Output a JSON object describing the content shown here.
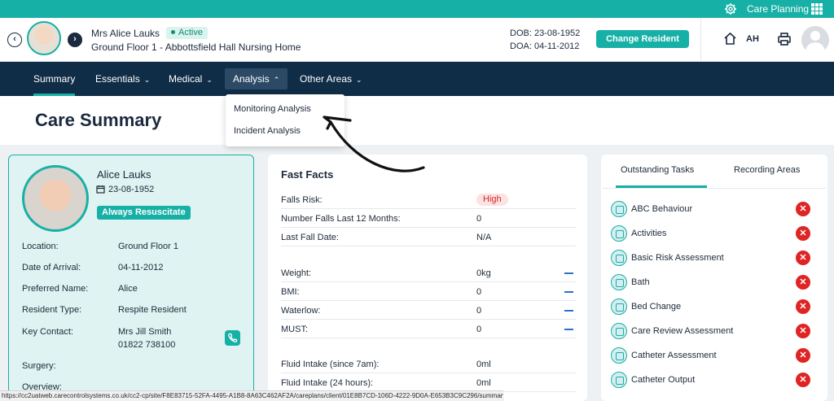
{
  "topbar": {
    "link_label": "Care Planning",
    "settings_icon": "gear-icon",
    "apps_icon": "grid-icon"
  },
  "header": {
    "resident_name": "Mrs Alice Lauks",
    "status": "Active",
    "location": "Ground Floor 1 - Abbottsfield Hall Nursing Home",
    "dob": "DOB: 23-08-1952",
    "doa": "DOA: 04-11-2012",
    "change_button": "Change Resident",
    "user_initials": "AH",
    "prev_label": "‹",
    "next_label": "›"
  },
  "nav": {
    "items": [
      {
        "label": "Summary",
        "active": true
      },
      {
        "label": "Essentials"
      },
      {
        "label": "Medical"
      },
      {
        "label": "Analysis",
        "open": true
      },
      {
        "label": "Other Areas"
      }
    ],
    "chev_down": "⌄",
    "chev_up": "⌃"
  },
  "dropdown": {
    "items": [
      "Monitoring Analysis",
      "Incident Analysis"
    ]
  },
  "page": {
    "title": "Care Summary"
  },
  "profile": {
    "name": "Alice Lauks",
    "dob": "23-08-1952",
    "resus_badge": "Always Resuscitate",
    "fields": [
      {
        "label": "Location:",
        "value": "Ground Floor 1"
      },
      {
        "label": "Date of Arrival:",
        "value": "04-11-2012"
      },
      {
        "label": "Preferred Name:",
        "value": "Alice"
      },
      {
        "label": "Resident Type:",
        "value": "Respite Resident"
      },
      {
        "label": "Key Contact:",
        "value": "Mrs Jill Smith",
        "value2": "01822 738100"
      },
      {
        "label": "Surgery:",
        "value": ""
      },
      {
        "label": "Overview:",
        "value": ""
      }
    ]
  },
  "fast_facts": {
    "title": "Fast Facts",
    "rows": [
      {
        "label": "Falls Risk:",
        "value": "High"
      },
      {
        "label": "Number Falls Last 12 Months:",
        "value": "0"
      },
      {
        "label": "Last Fall Date:",
        "value": "N/A"
      },
      {
        "label": "Weight:",
        "value": "0kg"
      },
      {
        "label": "BMI:",
        "value": "0"
      },
      {
        "label": "Waterlow:",
        "value": "0"
      },
      {
        "label": "MUST:",
        "value": "0"
      },
      {
        "label": "Fluid Intake (since 7am):",
        "value": "0ml"
      },
      {
        "label": "Fluid Intake (24 hours):",
        "value": "0ml"
      }
    ]
  },
  "tasks_panel": {
    "tabs": [
      "Outstanding Tasks",
      "Recording Areas"
    ],
    "tasks": [
      "ABC Behaviour",
      "Activities",
      "Basic Risk Assessment",
      "Bath",
      "Bed Change",
      "Care Review Assessment",
      "Catheter Assessment",
      "Catheter Output"
    ],
    "remove_glyph": "✕"
  },
  "status_bar": {
    "url": "https://cc2uatweb.carecontrolsystems.co.uk/cc2-cp/site/F8E83715-52FA-4495-A1B8-8A63C462AF2A/careplans/client/01E8B7CD-106D-4222-9D0A-E653B3C9C296/summary#"
  }
}
